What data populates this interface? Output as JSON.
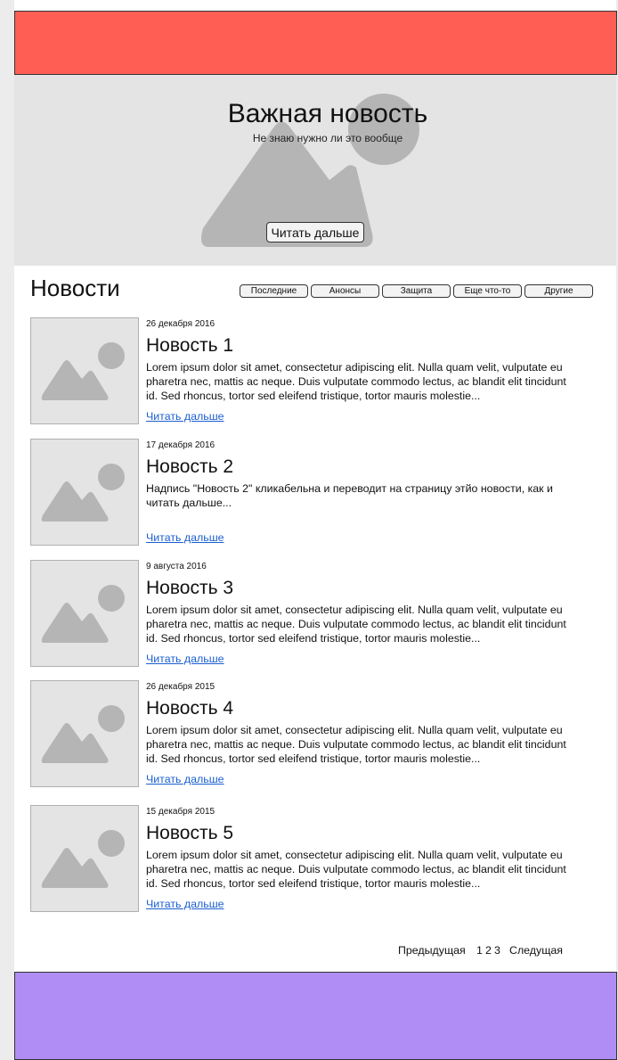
{
  "hero": {
    "title": "Важная новость",
    "subtitle": "Не знаю нужно ли это вообще",
    "button_label": "Читать дальше"
  },
  "news": {
    "heading": "Новости",
    "tabs": [
      "Последние",
      "Анонсы",
      "Защита",
      "Еще что-то",
      "Другие"
    ],
    "items": [
      {
        "date": "26 декабря 2016",
        "title": "Новость 1",
        "text": "Lorem ipsum dolor sit amet, consectetur adipiscing elit. Nulla quam velit, vulputate eu pharetra nec, mattis ac neque. Duis vulputate commodo lectus, ac blandit elit tincidunt id. Sed rhoncus, tortor sed eleifend tristique, tortor mauris molestie...",
        "more": "Читать дальше"
      },
      {
        "date": "17 декабря 2016",
        "title": "Новость 2",
        "text": "Надпись \"Новость 2\" кликабельна и переводит на страницу этйо новости, как и читать дальше...",
        "more": "Читать дальше"
      },
      {
        "date": "9 августа 2016",
        "title": "Новость 3",
        "text": "Lorem ipsum dolor sit amet, consectetur adipiscing elit. Nulla quam velit, vulputate eu pharetra nec, mattis ac neque. Duis vulputate commodo lectus, ac blandit elit tincidunt id. Sed rhoncus, tortor sed eleifend tristique, tortor mauris molestie...",
        "more": "Читать дальше"
      },
      {
        "date": "26 декабря 2015",
        "title": "Новость 4",
        "text": "Lorem ipsum dolor sit amet, consectetur adipiscing elit. Nulla quam velit, vulputate eu pharetra nec, mattis ac neque. Duis vulputate commodo lectus, ac blandit elit tincidunt id. Sed rhoncus, tortor sed eleifend tristique, tortor mauris molestie...",
        "more": "Читать дальше"
      },
      {
        "date": "15 декабря 2015",
        "title": "Новость 5",
        "text": "Lorem ipsum dolor sit amet, consectetur adipiscing elit. Nulla quam velit, vulputate eu pharetra nec, mattis ac neque. Duis vulputate commodo lectus, ac blandit elit tincidunt id. Sed rhoncus, tortor sed eleifend tristique, tortor mauris molestie...",
        "more": "Читать дальше"
      }
    ]
  },
  "pagination": {
    "prev": "Предыдущая",
    "pages": [
      "1",
      "2",
      "3"
    ],
    "next": "Следущая"
  },
  "colors": {
    "top_banner": "#ff5e55",
    "footer": "#b08df5",
    "placeholder": "#b5b5b5"
  },
  "icons": {
    "image_placeholder": "image-placeholder-icon"
  }
}
